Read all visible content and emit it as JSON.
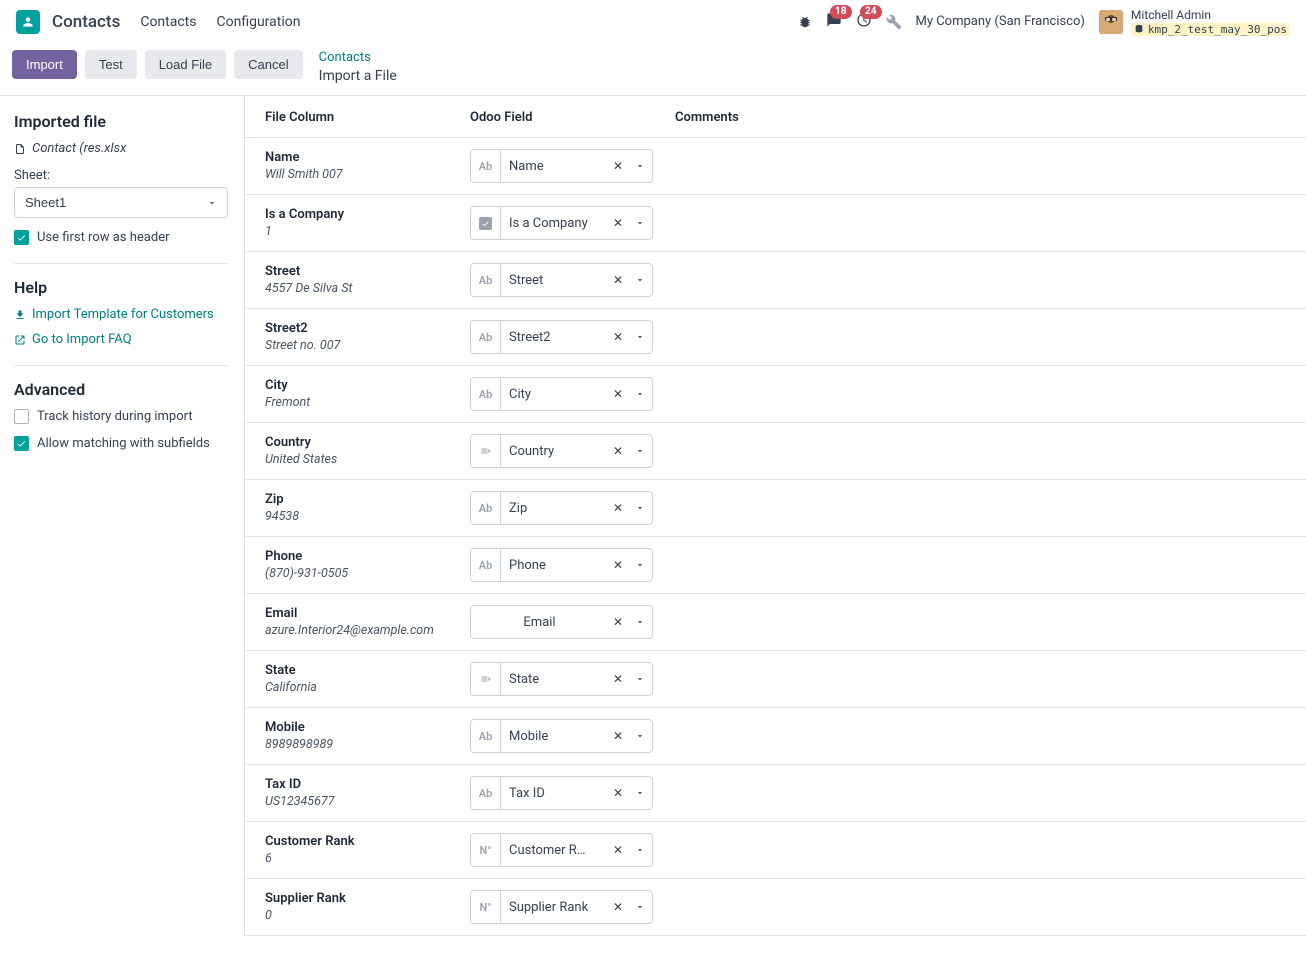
{
  "header": {
    "app_title": "Contacts",
    "nav": [
      "Contacts",
      "Configuration"
    ],
    "messages_count": "18",
    "activities_count": "24",
    "company": "My Company (San Francisco)",
    "user_name": "Mitchell Admin",
    "db_name": "kmp_2_test_may_30_pos"
  },
  "actionbar": {
    "import": "Import",
    "test": "Test",
    "load_file": "Load File",
    "cancel": "Cancel",
    "breadcrumb_parent": "Contacts",
    "breadcrumb_current": "Import a File"
  },
  "sidebar": {
    "imported_heading": "Imported file",
    "filename": "Contact (res.xlsx",
    "sheet_label": "Sheet:",
    "sheet_value": "Sheet1",
    "first_row_header": "Use first row as header",
    "help_heading": "Help",
    "help_template": "Import Template for Customers",
    "help_faq": "Go to Import FAQ",
    "advanced_heading": "Advanced",
    "track_history": "Track history during import",
    "allow_subfields": "Allow matching with subfields"
  },
  "table": {
    "col_file": "File Column",
    "col_odoo": "Odoo Field",
    "col_comments": "Comments"
  },
  "rows": [
    {
      "name": "Name",
      "sample": "Will Smith 007",
      "field": "Name",
      "type": "text"
    },
    {
      "name": "Is a Company",
      "sample": "1",
      "field": "Is a Company",
      "type": "bool"
    },
    {
      "name": "Street",
      "sample": "4557 De Silva St",
      "field": "Street",
      "type": "text"
    },
    {
      "name": "Street2",
      "sample": "Street no. 007",
      "field": "Street2",
      "type": "text"
    },
    {
      "name": "City",
      "sample": "Fremont",
      "field": "City",
      "type": "text"
    },
    {
      "name": "Country",
      "sample": "United States",
      "field": "Country",
      "type": "rel"
    },
    {
      "name": "Zip",
      "sample": "94538",
      "field": "Zip",
      "type": "text"
    },
    {
      "name": "Phone",
      "sample": "(870)-931-0505",
      "field": "Phone",
      "type": "text"
    },
    {
      "name": "Email",
      "sample": "azure.Interior24@example.com",
      "field": "Email",
      "type": "none"
    },
    {
      "name": "State",
      "sample": "California",
      "field": "State",
      "type": "rel"
    },
    {
      "name": "Mobile",
      "sample": "8989898989",
      "field": "Mobile",
      "type": "text"
    },
    {
      "name": "Tax ID",
      "sample": "US12345677",
      "field": "Tax ID",
      "type": "text"
    },
    {
      "name": "Customer Rank",
      "sample": "6",
      "field": "Customer R…",
      "type": "num"
    },
    {
      "name": "Supplier Rank",
      "sample": "0",
      "field": "Supplier Rank",
      "type": "num"
    }
  ]
}
